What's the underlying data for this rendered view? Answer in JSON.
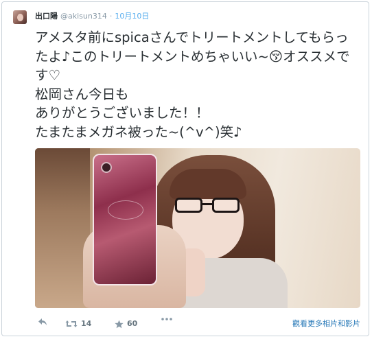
{
  "user": {
    "name": "出口陽",
    "handle": "@akisun314",
    "separator": "·",
    "timestamp": "10月10日"
  },
  "tweet": {
    "text": "アメスタ前にspicaさんでトリートメントしてもらったよ♪このトリートメントめちゃいい~😚オススメです♡\n松岡さん今日も\nありがとうございました！！\nたまたまメガネ被った~(^v^)笑♪"
  },
  "actions": {
    "retweet_count": "14",
    "favorite_count": "60",
    "more_media_link": "觀看更多相片和影片"
  },
  "icons": {
    "reply": "reply-icon",
    "retweet": "retweet-icon",
    "favorite": "star-icon",
    "more": "more-dots-icon"
  },
  "colors": {
    "link": "#55acee",
    "action_gray": "#8899a6",
    "text": "#292f33"
  }
}
